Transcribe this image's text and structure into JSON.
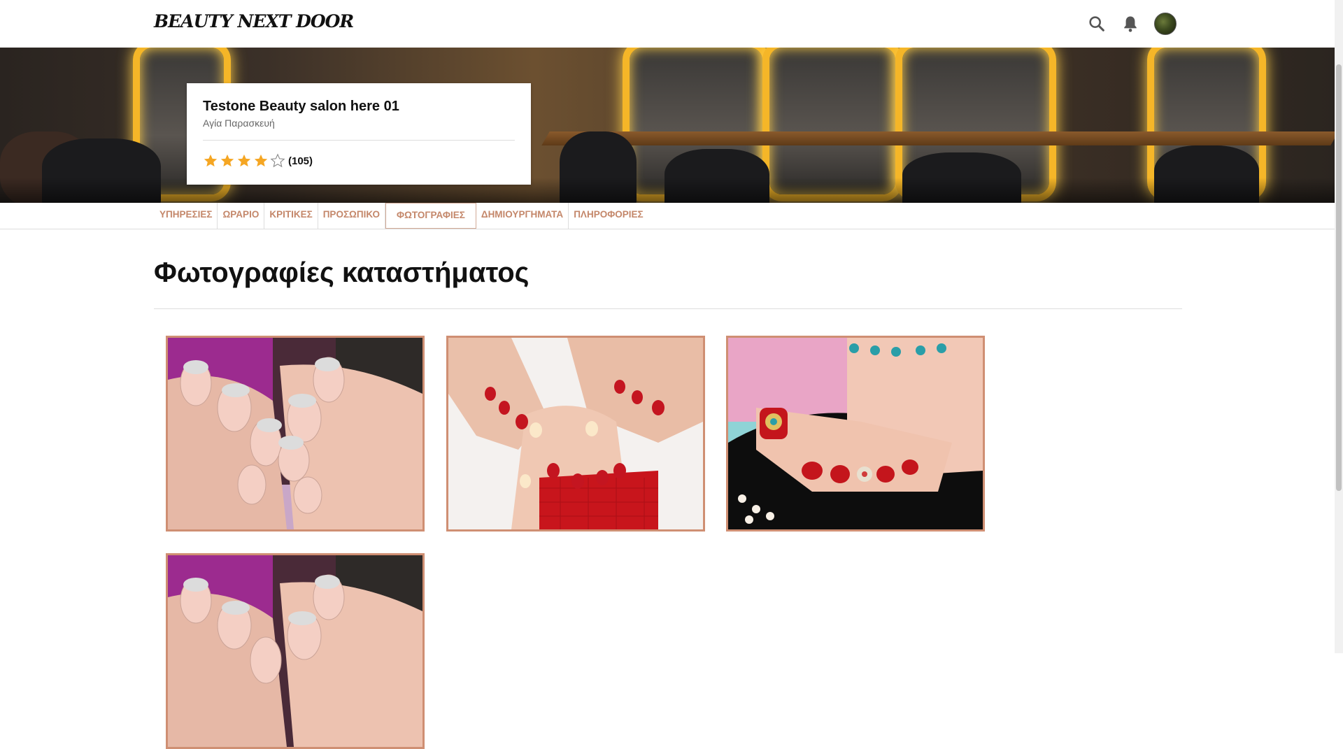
{
  "header": {
    "brand": "BEAUTY NEXT DOOR",
    "icons": [
      "search-icon",
      "bell-icon",
      "avatar"
    ]
  },
  "salon": {
    "name": "Testone Beauty salon here 01",
    "area": "Αγία Παρασκευή",
    "rating": 4,
    "rating_max": 5,
    "review_count": "(105)"
  },
  "tabs": [
    {
      "label": "ΥΠΗΡΕΣΙΕΣ",
      "active": false
    },
    {
      "label": "ΩΡΑΡΙΟ",
      "active": false
    },
    {
      "label": "ΚΡΙΤΙΚΕΣ",
      "active": false
    },
    {
      "label": "ΠΡΟΣΩΠΙΚΟ",
      "active": false
    },
    {
      "label": "ΦΩΤΟΓΡΑΦΙΕΣ",
      "active": true
    },
    {
      "label": "ΔΗΜΙΟΥΡΓΗΜΑΤΑ",
      "active": false
    },
    {
      "label": "ΠΛΗΡΟΦΟΡΙΕΣ",
      "active": false
    }
  ],
  "main": {
    "title": "Φωτογραφίες καταστήματος",
    "photos": [
      "glitter-french-nails",
      "red-floral-nails-and-toes",
      "jeweled-toe-pedicure",
      "glitter-french-nails"
    ]
  },
  "colors": {
    "accent": "#c4876a",
    "photo_border": "#cf8f73",
    "star": "#f5a623"
  }
}
